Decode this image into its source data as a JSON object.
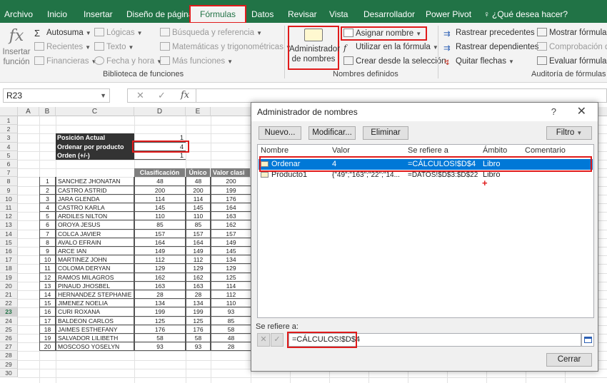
{
  "tabs": [
    {
      "label": "Archivo"
    },
    {
      "label": "Inicio"
    },
    {
      "label": "Insertar"
    },
    {
      "label": "Diseño de página"
    },
    {
      "label": "Fórmulas"
    },
    {
      "label": "Datos"
    },
    {
      "label": "Revisar"
    },
    {
      "label": "Vista"
    },
    {
      "label": "Desarrollador"
    },
    {
      "label": "Power Pivot"
    },
    {
      "label": "¿Qué desea hacer?"
    }
  ],
  "ribbon": {
    "insert_function": "Insertar función",
    "library": {
      "autosum": "Autosuma",
      "recent": "Recientes",
      "financial": "Financieras",
      "logical": "Lógicas",
      "text": "Texto",
      "datetime": "Fecha y hora",
      "lookup": "Búsqueda y referencia",
      "math": "Matemáticas y trigonométricas",
      "more": "Más funciones",
      "label": "Biblioteca de funciones"
    },
    "names": {
      "manager": "Administrador de nombres",
      "define": "Asignar nombre",
      "use_in_formula": "Utilizar en la fórmula",
      "create_from_selection": "Crear desde la selección",
      "label": "Nombres definidos"
    },
    "audit": {
      "trace_precedents": "Rastrear precedentes",
      "trace_dependents": "Rastrear dependientes",
      "remove_arrows": "Quitar flechas",
      "show_formulas": "Mostrar fórmulas",
      "error_checking": "Comprobación de e",
      "evaluate": "Evaluar fórmula",
      "label": "Auditoría de fórmulas"
    }
  },
  "formula_bar": {
    "name_box": "R23",
    "fx": "fx"
  },
  "columns": [
    "A",
    "B",
    "C",
    "D",
    "E"
  ],
  "rows": [
    "1",
    "2",
    "3",
    "4",
    "5",
    "6",
    "7",
    "8",
    "9",
    "10",
    "11",
    "12",
    "13",
    "14",
    "15",
    "16",
    "17",
    "18",
    "19",
    "20",
    "21",
    "22",
    "23",
    "24",
    "25",
    "26",
    "27",
    "28",
    "29",
    "30"
  ],
  "sheet": {
    "labels": {
      "position": "Posición Actual",
      "sort_by": "Ordenar por producto",
      "order": "Orden (+/-)"
    },
    "values": {
      "position": "1",
      "sort_by": "4",
      "order": "1"
    },
    "headers": {
      "rank": "Clasificación",
      "unique": "Único",
      "value": "Valor clasi"
    },
    "data": [
      {
        "n": "1",
        "name": "SANCHEZ JHONATAN",
        "rank": "48",
        "unique": "48",
        "value": "200"
      },
      {
        "n": "2",
        "name": "CASTRO ASTRID",
        "rank": "200",
        "unique": "200",
        "value": "199"
      },
      {
        "n": "3",
        "name": "JARA GLENDA",
        "rank": "114",
        "unique": "114",
        "value": "176"
      },
      {
        "n": "4",
        "name": "CASTRO KARLA",
        "rank": "145",
        "unique": "145",
        "value": "164"
      },
      {
        "n": "5",
        "name": "ARDILES NILTON",
        "rank": "110",
        "unique": "110",
        "value": "163"
      },
      {
        "n": "6",
        "name": "OROYA JESUS",
        "rank": "85",
        "unique": "85",
        "value": "162"
      },
      {
        "n": "7",
        "name": "COLCA JAVIER",
        "rank": "157",
        "unique": "157",
        "value": "157"
      },
      {
        "n": "8",
        "name": "AVALO EFRAIN",
        "rank": "164",
        "unique": "164",
        "value": "149"
      },
      {
        "n": "9",
        "name": "ARCE IAN",
        "rank": "149",
        "unique": "149",
        "value": "145"
      },
      {
        "n": "10",
        "name": "MARTINEZ JOHN",
        "rank": "112",
        "unique": "112",
        "value": "134"
      },
      {
        "n": "11",
        "name": "COLOMA DERYAN",
        "rank": "129",
        "unique": "129",
        "value": "129"
      },
      {
        "n": "12",
        "name": "RAMOS MILAGROS",
        "rank": "162",
        "unique": "162",
        "value": "125"
      },
      {
        "n": "13",
        "name": "PINAUD JHOSBEL",
        "rank": "163",
        "unique": "163",
        "value": "114"
      },
      {
        "n": "14",
        "name": "HERNANDEZ STEPHANIE",
        "rank": "28",
        "unique": "28",
        "value": "112"
      },
      {
        "n": "15",
        "name": "JIMENEZ NOELIA",
        "rank": "134",
        "unique": "134",
        "value": "110"
      },
      {
        "n": "16",
        "name": "CURI ROXANA",
        "rank": "199",
        "unique": "199",
        "value": "93"
      },
      {
        "n": "17",
        "name": "BALDEON CARLOS",
        "rank": "125",
        "unique": "125",
        "value": "85"
      },
      {
        "n": "18",
        "name": "JAIMES ESTHEFANY",
        "rank": "176",
        "unique": "176",
        "value": "58"
      },
      {
        "n": "19",
        "name": "SALVADOR LILIBETH",
        "rank": "58",
        "unique": "58",
        "value": "48"
      },
      {
        "n": "20",
        "name": "MOSCOSO YOSELYN",
        "rank": "93",
        "unique": "93",
        "value": "28"
      }
    ]
  },
  "dialog": {
    "title": "Administrador de nombres",
    "help": "?",
    "close": "✕",
    "buttons": {
      "new": "Nuevo...",
      "edit": "Modificar...",
      "delete": "Eliminar",
      "filter": "Filtro",
      "close": "Cerrar"
    },
    "columns": {
      "name": "Nombre",
      "value": "Valor",
      "refers": "Se refiere a",
      "scope": "Ámbito",
      "comment": "Comentario"
    },
    "names": [
      {
        "name": "Ordenar",
        "value": "4",
        "refers": "=CÁLCULOS!$D$4",
        "scope": "Libro",
        "comment": ""
      },
      {
        "name": "Producto1",
        "value": "{\"49\";\"163\";\"22\";\"14...",
        "refers": "=DATOS!$D$3:$D$22",
        "scope": "Libro",
        "comment": ""
      }
    ],
    "refers_label": "Se refiere a:",
    "refers_value": "=CÁLCULOS!$D$4"
  },
  "colors": {
    "excel_green": "#217346",
    "highlight_red": "#e01b1b",
    "selection_blue": "#0078d7"
  }
}
